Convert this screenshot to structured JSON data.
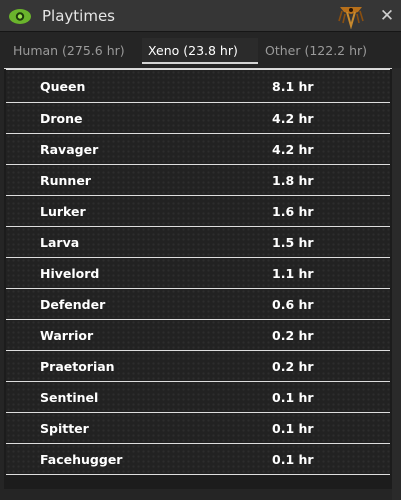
{
  "window": {
    "title": "Playtimes",
    "close_label": "✕"
  },
  "tabs": [
    {
      "label": "Human (275.6 hr)",
      "selected": false
    },
    {
      "label": "Xeno (23.8 hr)",
      "selected": true
    },
    {
      "label": "Other (122.2 hr)",
      "selected": false
    }
  ],
  "table": {
    "rows": [
      {
        "name": "Queen",
        "time": "8.1 hr"
      },
      {
        "name": "Drone",
        "time": "4.2 hr"
      },
      {
        "name": "Ravager",
        "time": "4.2 hr"
      },
      {
        "name": "Runner",
        "time": "1.8 hr"
      },
      {
        "name": "Lurker",
        "time": "1.6 hr"
      },
      {
        "name": "Larva",
        "time": "1.5 hr"
      },
      {
        "name": "Hivelord",
        "time": "1.1 hr"
      },
      {
        "name": "Defender",
        "time": "0.6 hr"
      },
      {
        "name": "Warrior",
        "time": "0.2 hr"
      },
      {
        "name": "Praetorian",
        "time": "0.2 hr"
      },
      {
        "name": "Sentinel",
        "time": "0.1 hr"
      },
      {
        "name": "Spitter",
        "time": "0.1 hr"
      },
      {
        "name": "Facehugger",
        "time": "0.1 hr"
      }
    ]
  },
  "colors": {
    "eye_icon": "#6ab42c",
    "emblem_icon": "#b8701a",
    "titlebar": "#363636",
    "row_border": "#dedede"
  }
}
